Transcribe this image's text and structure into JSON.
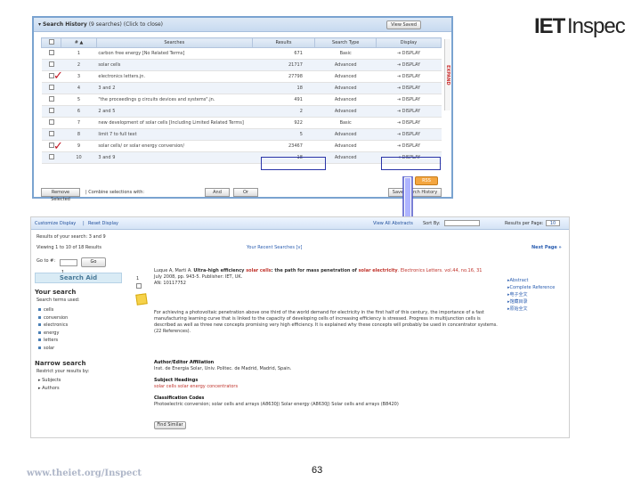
{
  "logo": {
    "iet": "IET",
    "inspec": "Inspec"
  },
  "search_history": {
    "title": "Search History",
    "subtitle": "(9 searches) (Click to close)",
    "view_saved": "View Saved",
    "columns": [
      "",
      "# ▲",
      "Searches",
      "Results",
      "Search Type",
      "Display"
    ],
    "rows": [
      {
        "num": "1",
        "query": "carbon free energy [No Related Terms]",
        "results": "671",
        "type": "Basic",
        "display": "DISPLAY"
      },
      {
        "num": "2",
        "query": "solar cells",
        "results": "21717",
        "type": "Advanced",
        "display": "DISPLAY"
      },
      {
        "num": "3",
        "query": "electronics letters.jn.",
        "results": "27798",
        "type": "Advanced",
        "display": "DISPLAY"
      },
      {
        "num": "4",
        "query": "3 and 2",
        "results": "18",
        "type": "Advanced",
        "display": "DISPLAY"
      },
      {
        "num": "5",
        "query": "\"the proceedings g circuits devices and systems\".jn.",
        "results": "491",
        "type": "Advanced",
        "display": "DISPLAY"
      },
      {
        "num": "6",
        "query": "2 and 5",
        "results": "2",
        "type": "Advanced",
        "display": "DISPLAY"
      },
      {
        "num": "7",
        "query": "new development of solar cells [Including Limited Related Terms]",
        "results": "922",
        "type": "Basic",
        "display": "DISPLAY"
      },
      {
        "num": "8",
        "query": "limit 7 to full text",
        "results": "5",
        "type": "Advanced",
        "display": "DISPLAY"
      },
      {
        "num": "9",
        "query": "solar cells/ or solar energy conversion/",
        "results": "23467",
        "type": "Advanced",
        "display": "DISPLAY"
      },
      {
        "num": "10",
        "query": "3 and 9",
        "results": "18",
        "type": "Advanced",
        "display": "DISPLAY"
      }
    ],
    "side_tab": "EXPAND",
    "remove_selected": "Remove Selected",
    "combine_label": "| Combine selections with:",
    "and_label": "And",
    "or_label": "Or",
    "save_search": "Save Search History",
    "rss": "RSS"
  },
  "results": {
    "nav": {
      "customize": "Customize Display",
      "separator": "|",
      "reset": "Reset Display",
      "view_all": "View All Abstracts",
      "sort_by": "Sort By:",
      "per_page": "Results per Page:",
      "per_page_value": "10"
    },
    "results_for": "Results of your search: 3 and 9",
    "viewing": "Viewing 1 to 10 of 18 Results",
    "recent_searches": "Your Recent Searches",
    "recent_searches_count": "[v]",
    "next_page": "Next Page »",
    "go_to": "Go to #:",
    "go_value": "1",
    "go_button": "Go",
    "search_aid": "Search Aid",
    "your_search": "Your search",
    "search_terms_used": "Search terms used:",
    "terms": [
      "cells",
      "conversion",
      "electronics",
      "energy",
      "letters",
      "solar"
    ],
    "narrow_search": "Narrow search",
    "restrict_label": "Restrict your results by:",
    "narrow_items": [
      "Subjects",
      "Authors"
    ],
    "record": {
      "index": "1",
      "authors": "Luque A, Marti A.",
      "title_pre": "Ultra-high efficiency",
      "title_hl1": "solar cells",
      "title_mid": ": the path for mass penetration of",
      "title_hl2": "solar electricity",
      "journal": ". Electronics Letters. vol.44, no.16, 31",
      "date_pub": "July 2008, pp. 943-5. Publisher: IET, UK.",
      "an": "AN: 10117752",
      "abstract": "For achieving a photovoltaic penetration above one third of the world demand for electricity in the first half of this century, the importance of a fast manufacturing learning curve that is linked to the capacity of developing cells of increasing efficiency is stressed. Progress in multijunction cells is described as well as three new concepts promising very high efficiency. It is explained why these concepts will probably be used in concentrator systems. (22 References).",
      "affiliation_label": "Author/Editor Affiliation",
      "affiliation": "Inst. de Energia Solar, Univ. Politec. de Madrid, Madrid, Spain.",
      "subject_label": "Subject Headings",
      "subjects": "solar cells solar energy concentrators",
      "classification_label": "Classification Codes",
      "classification": "Photoelectric conversion; solar cells and arrays (A8630J) Solar energy (A8630J) Solar cells and arrays (B8420)",
      "find_similar": "Find Similar"
    },
    "right_links": [
      "Abstract",
      "Complete Reference",
      "电子全文",
      "馆藏目录",
      "原始全文"
    ]
  },
  "footer": {
    "url": "www.theiet.org/Inspect",
    "page": "63"
  },
  "colors": {
    "accent": "#2a5db0",
    "check": "#c1121f",
    "highlight_box": "#2a35a8",
    "arrow": "#5a66ff"
  }
}
